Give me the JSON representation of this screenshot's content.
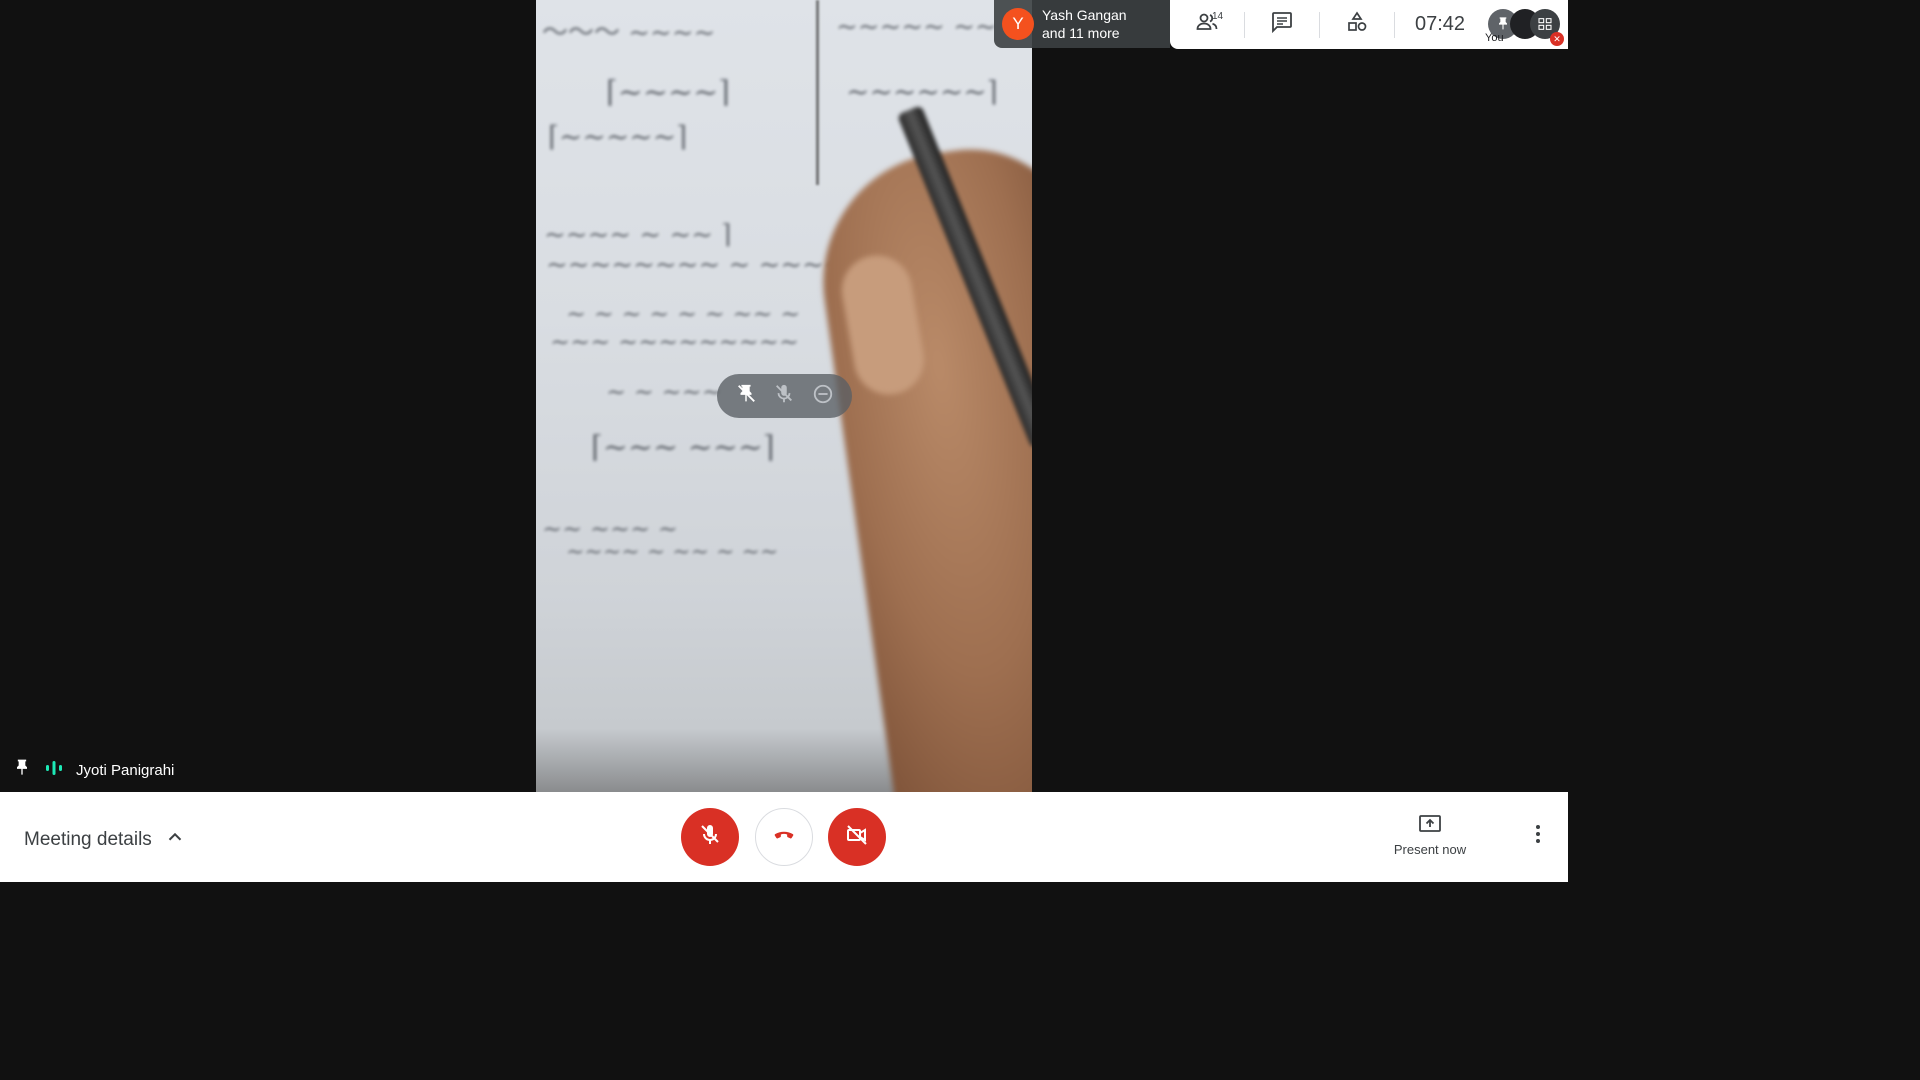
{
  "presenter": {
    "name": "Jyoti Panigrahi"
  },
  "speaker_chip": {
    "initial": "Y",
    "line1": "Yash Gangan",
    "line2": "and 11 more",
    "avatar_color": "#f4511e"
  },
  "toolbar": {
    "participants_count": "14",
    "clock": "07:42",
    "self_label": "You"
  },
  "bottom": {
    "meeting_details": "Meeting details",
    "present_now": "Present now"
  },
  "colors": {
    "danger": "#d93025",
    "text": "#3c4043",
    "audio_indicator": "#1de9b6"
  },
  "icons": {
    "pin": "pin-icon",
    "audio": "audio-level-icon",
    "chevron": "chevron-up-icon",
    "mic_off": "mic-off-icon",
    "hangup": "hang-up-icon",
    "cam_off": "camera-off-icon",
    "present": "present-screen-icon",
    "more": "more-vert-icon",
    "people": "people-icon",
    "chat": "chat-icon",
    "activities": "activities-icon"
  }
}
